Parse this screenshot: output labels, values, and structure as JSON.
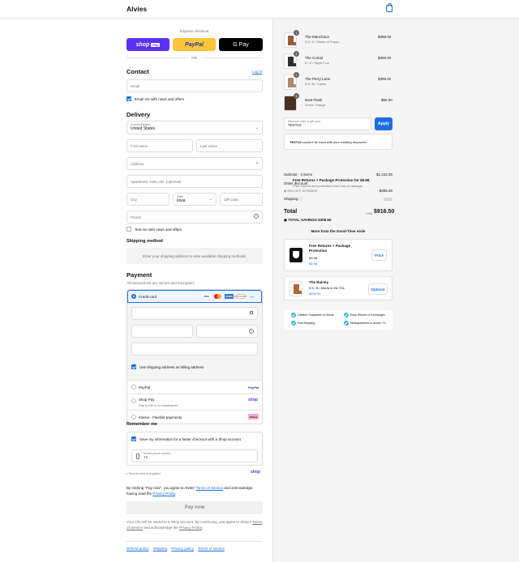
{
  "header": {
    "brand": "Alvies"
  },
  "express": {
    "label": "Express checkout",
    "shop_pay": "shop",
    "shop_pay_tag": "Pay",
    "paypal": "PayPal",
    "gpay": "G Pay",
    "or": "OR"
  },
  "contact": {
    "title": "Contact",
    "login": "Log in",
    "email_placeholder": "Email",
    "news_label": "Email me with news and offers"
  },
  "delivery": {
    "title": "Delivery",
    "country_label": "Country/Region",
    "country": "United States",
    "first_name": "First name",
    "last_name": "Last name",
    "address": "Address",
    "apartment": "Apartment, suite, etc. (optional)",
    "city": "City",
    "state_label": "State",
    "state": "Iowa",
    "zip": "ZIP code",
    "phone": "Phone",
    "text_label": "Text me with news and offers"
  },
  "shipping": {
    "title": "Shipping method",
    "message": "Enter your shipping address to view available shipping methods."
  },
  "payment": {
    "title": "Payment",
    "subtitle": "All transactions are secure and encrypted.",
    "credit_card": "Credit card",
    "card_brands": [
      "VISA",
      "MC",
      "AMEX",
      "DISCOVER",
      "+5"
    ],
    "billing_label": "Use shipping address as billing address",
    "paypal": "PayPal",
    "paypal_logo": "PayPal",
    "shop_pay": "Shop Pay",
    "shop_pay_sub": "Pay in full or in installments",
    "shop_pay_logo": "shop",
    "klarna": "Klarna - Flexible payments",
    "klarna_logo": "Klarna"
  },
  "remember": {
    "title": "Remember me",
    "save_label": "Save my information for a faster checkout with a Shop account",
    "mobile_label": "Mobile phone number",
    "mobile_value": "+1",
    "secure": "Secure and encrypted",
    "shop_logo": "shop"
  },
  "terms": {
    "prefix": "By clicking \"Pay now\", you agree to Alvies'",
    "terms_link": "Terms of Service",
    "middle": "and acknowledge having read the",
    "privacy_link": "Privacy Policy",
    "suffix": "."
  },
  "pay_now": "Pay now",
  "shop_notice": {
    "prefix": "Your info will be saved to a Shop account. By continuing, you agree to Shop's",
    "terms_link": "Terms of Service",
    "middle": "and acknowledge the",
    "privacy_link": "Privacy Policy",
    "suffix": "."
  },
  "footer": {
    "links": [
      "Refund policy",
      "Shipping",
      "Privacy policy",
      "Terms of service"
    ]
  },
  "cart": {
    "items": [
      {
        "name": "The Manchaca",
        "variant": "9.5 / D / Brass of Poppy",
        "price": "$399.00",
        "qty": "1",
        "color": "#9a5a3a"
      },
      {
        "name": "The Comal",
        "variant": "6 / D / Night Foot",
        "price": "$359.00",
        "qty": "1",
        "color": "#2d2d2d"
      },
      {
        "name": "The Perry Lane",
        "variant": "5.5 / B / Caelin",
        "price": "$399.00",
        "qty": "1",
        "color": "#b08970"
      },
      {
        "name": "Boot Flask",
        "variant": "Green Thangs",
        "price": "$65.00",
        "qty": "1",
        "color": "#4a3020"
      }
    ]
  },
  "discount": {
    "label": "Discount code or gift card",
    "value": "TEXT10",
    "apply": "Apply",
    "error_code": "TEXT10",
    "error_text": "couldn't be used with your existing discounts."
  },
  "protection": {
    "title": "Free Returns + Package Protection for $5.98",
    "subtitle": "Free returns and protection from loss or damage"
  },
  "summary": {
    "subtotal_label": "Subtotal · 4 items",
    "subtotal": "$1,222.00",
    "order_discount": "Order discount",
    "discount_code": "25% OFF SITEWIDE",
    "discount_value": "- $305.50",
    "shipping_label": "Shipping",
    "total_label": "Total",
    "currency": "USD",
    "total": "$916.50",
    "savings_label": "TOTAL SAVINGS",
    "savings": "$305.50"
  },
  "upsell": {
    "title": "More from the Good-Time Aisle",
    "items": [
      {
        "name": "Free Returns + Package Protection",
        "price1": "$3.98",
        "price2": "$3.98",
        "button": "Price"
      },
      {
        "name": "The Rainey",
        "variant": "5.5 / B / Marfa in the 70s",
        "price": "$299.00",
        "button": "Options"
      }
    ]
  },
  "perks": [
    "Lifetime Guarantee on Boots",
    "Easy Returns & Exchanges",
    "Fast Shipping",
    "Headquartered in Austin, TX"
  ],
  "colors": {
    "accent": "#1a6fe0",
    "shop_pay": "#5a31f4",
    "paypal": "#ffc439",
    "gpay": "#000000"
  }
}
